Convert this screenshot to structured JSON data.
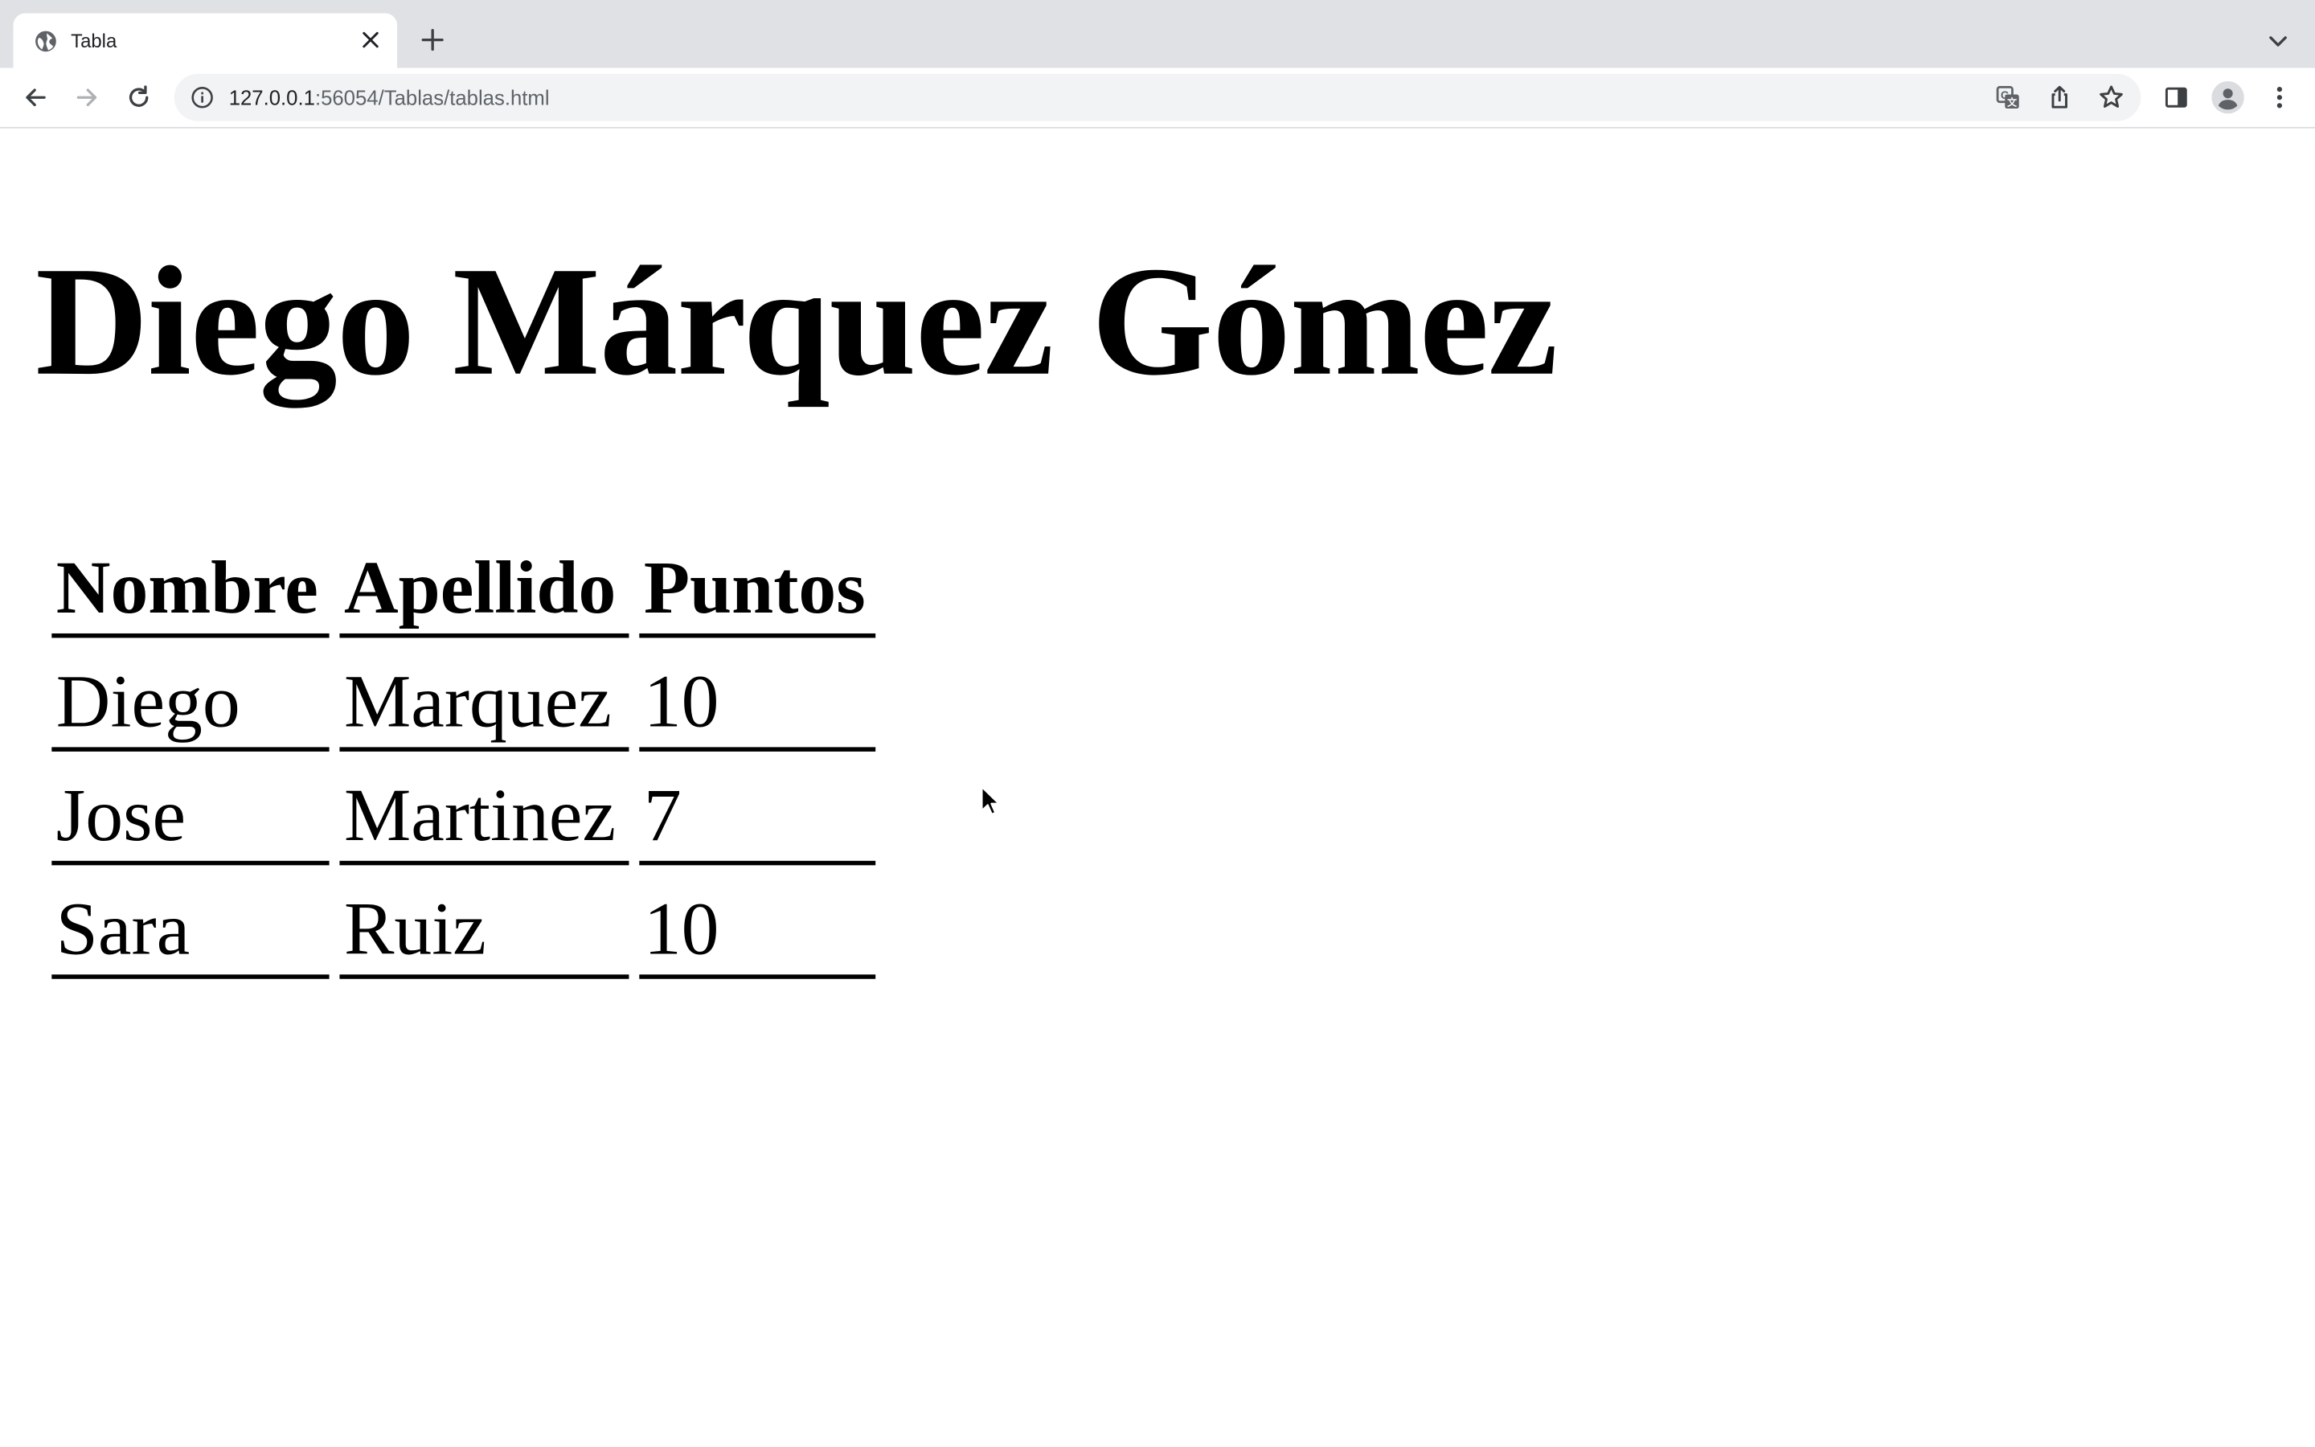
{
  "browser": {
    "tab": {
      "title": "Tabla",
      "favicon": "globe-icon",
      "close_icon": "close-icon"
    },
    "new_tab_icon": "plus-icon",
    "tab_search_icon": "chevron-down-icon",
    "toolbar": {
      "back_icon": "arrow-left-icon",
      "forward_icon": "arrow-right-icon",
      "reload_icon": "reload-icon",
      "site_info_icon": "info-icon",
      "url_host": "127.0.0.1",
      "url_rest": ":56054/Tablas/tablas.html",
      "translate_icon": "translate-icon",
      "share_icon": "share-icon",
      "bookmark_icon": "star-icon",
      "side_panel_icon": "side-panel-icon",
      "profile_icon": "profile-avatar-icon",
      "menu_icon": "kebab-menu-icon"
    }
  },
  "page": {
    "heading": "Diego Márquez Gómez",
    "table": {
      "headers": [
        "Nombre",
        "Apellido",
        "Puntos"
      ],
      "rows": [
        [
          "Diego",
          "Marquez",
          "10"
        ],
        [
          "Jose",
          "Martinez",
          "7"
        ],
        [
          "Sara",
          "Ruiz",
          "10"
        ]
      ]
    }
  },
  "colors": {
    "tabstrip_bg": "#dfe1e5",
    "omnibox_bg": "#f1f3f4",
    "icon_gray": "#5f6368",
    "text": "#000000"
  }
}
